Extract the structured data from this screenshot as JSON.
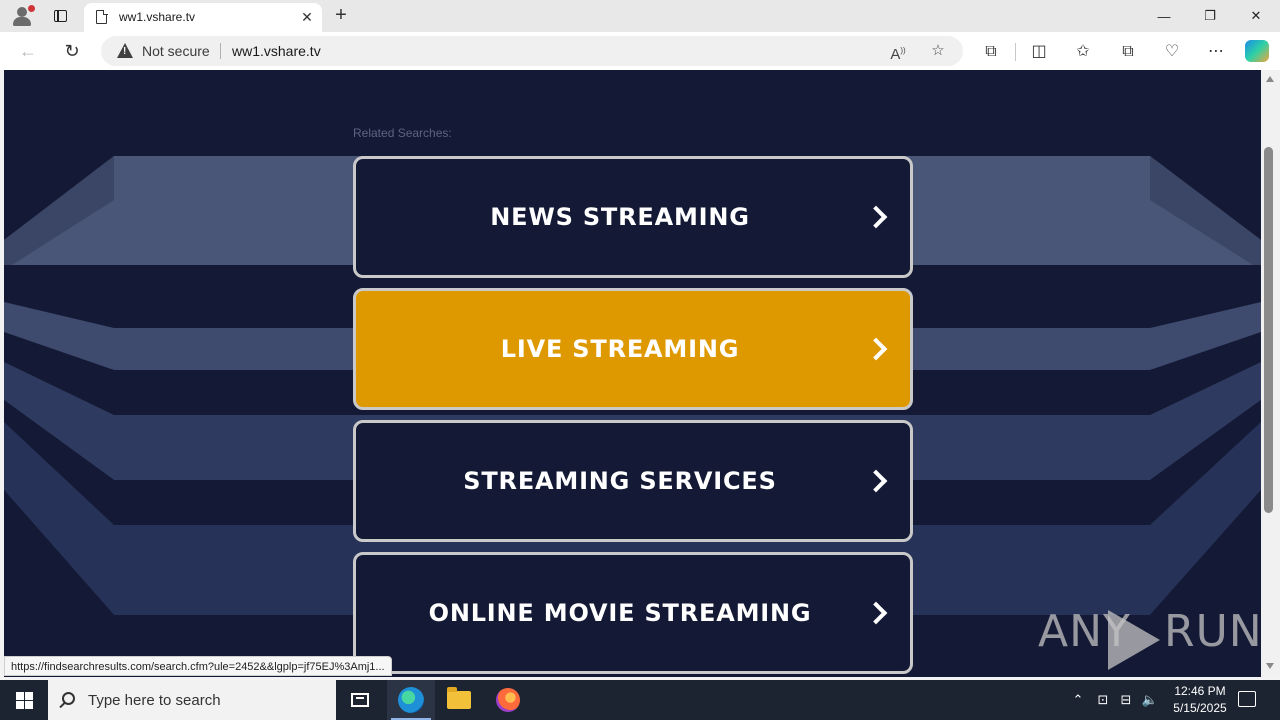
{
  "browser": {
    "tab_title": "ww1.vshare.tv",
    "close_tab_glyph": "✕",
    "new_tab_glyph": "+",
    "security_label": "Not secure",
    "url": "ww1.vshare.tv",
    "window_controls": {
      "minimize": "—",
      "restore": "❐",
      "close": "✕"
    },
    "icons": [
      "profile-icon",
      "tab-actions-icon",
      "page-icon",
      "back-icon",
      "reload-icon",
      "warning-icon",
      "read-aloud-icon",
      "favorite-icon",
      "extensions-icon",
      "split-screen-icon",
      "favorites-icon",
      "collections-icon",
      "browser-essentials-icon",
      "more-icon",
      "copilot-icon"
    ]
  },
  "page": {
    "related_label": "Related Searches:",
    "buttons": [
      {
        "label": "NEWS STREAMING",
        "state": "normal"
      },
      {
        "label": "LIVE STREAMING",
        "state": "highlighted"
      },
      {
        "label": "STREAMING SERVICES",
        "state": "normal"
      },
      {
        "label": "ONLINE MOVIE STREAMING",
        "state": "normal"
      }
    ],
    "colors": {
      "background": "#141a35",
      "highlight": "#df9900",
      "border": "#c9c9c9"
    }
  },
  "status_url": "https://findsearchresults.com/search.cfm?ule=2452&&lgplp=jf75EJ%3Amj1...",
  "watermark": {
    "left": "ANY",
    "right": "RUN"
  },
  "taskbar": {
    "search_placeholder": "Type here to search",
    "time": "12:46 PM",
    "date": "5/15/2025",
    "apps": [
      "task-view",
      "edge",
      "file-explorer",
      "firefox"
    ]
  }
}
